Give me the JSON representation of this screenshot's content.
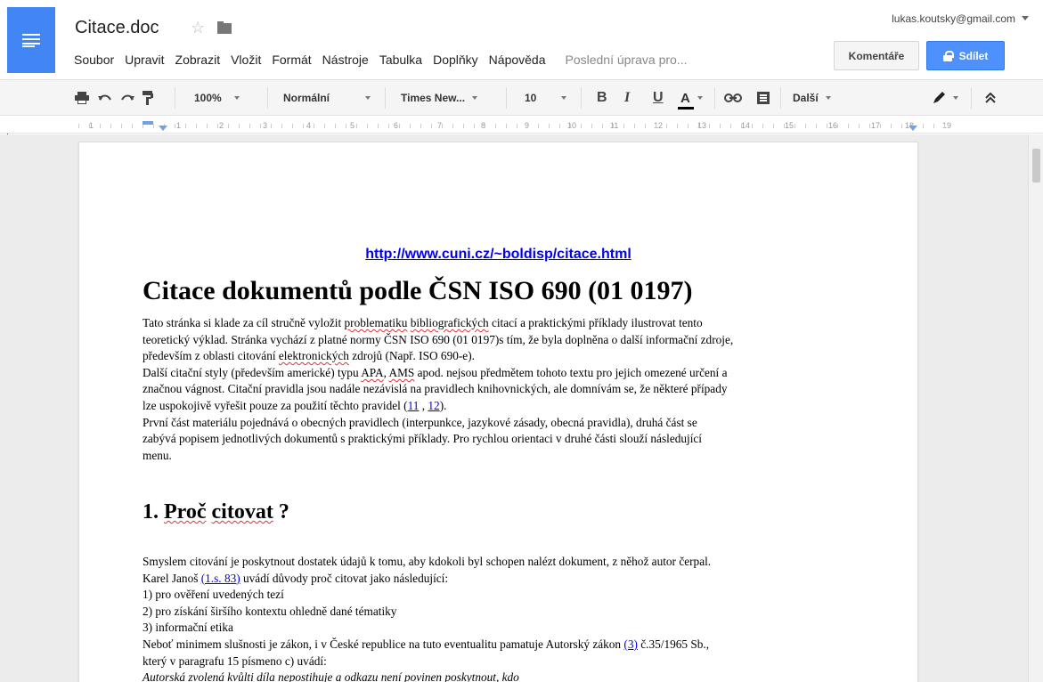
{
  "app": {
    "doc_title": "Citace.doc",
    "icons": [
      "docs-menu-icon",
      "star-icon",
      "folder-icon"
    ]
  },
  "menu": {
    "items": [
      "Soubor",
      "Upravit",
      "Zobrazit",
      "Vložit",
      "Formát",
      "Nástroje",
      "Tabulka",
      "Doplňky",
      "Nápověda"
    ],
    "last_edit": "Poslední úprava pro..."
  },
  "account": {
    "email": "lukas.koutsky@gmail.com"
  },
  "buttons": {
    "comments": "Komentáře",
    "share": "Sdílet"
  },
  "toolbar": {
    "zoom": "100%",
    "style": "Normální",
    "font": "Times New...",
    "size": "10",
    "bold": "B",
    "italic": "I",
    "underline": "U",
    "text_color": "A",
    "more": "Další"
  },
  "ruler": {
    "numbers": [
      "1",
      "1",
      "2",
      "3",
      "4",
      "5",
      "6",
      "7",
      "8",
      "9",
      "10",
      "11",
      "12",
      "13",
      "14",
      "15",
      "16",
      "17",
      "18",
      "19"
    ]
  },
  "document": {
    "link": "http://www.cuni.cz/~boldisp/citace.html",
    "heading1": "Citace dokumentů podle ČSN ISO 690 (01 0197)",
    "intro": {
      "l1a": "Tato stránka si klade za cíl stručně vyložit ",
      "l1b": "problematiku",
      "l1c": " ",
      "l1d": "bibliografických",
      "l1e": " citací a praktickými příklady ilustrovat tento",
      "l2": "teoretický výklad. Stránka vychází z platné normy ČSN ISO 690 (01 0197)s tím, že byla doplněna o další informační zdroje,",
      "l3a": "především z oblasti citování ",
      "l3b": "elektronických",
      "l3c": " zdrojů (Např. ISO 690-e).",
      "l4a": "Další citační styly (především americké) typu ",
      "l4b": "APA",
      "l4c": ", ",
      "l4d": "AMS",
      "l4e": " apod. nejsou předmětem tohoto textu pro jejich omezené určení a",
      "l5": "značnou vágnost. Citační pravidla jsou nadále nezávislá na pravidlech knihovnických, ale domnívám se, že některé případy",
      "l6a": "lze uspokojivě vyřešit pouze za použití těchto pravidel (",
      "l6b": "11",
      "l6c": " , ",
      "l6d": "12",
      "l6e": ").",
      "l7": "První část materiálu pojednává o obecných pravidlech (interpunkce, jazykové zásady, obecná pravidla), druhá část se",
      "l8": "zabývá popisem jednotlivých dokumentů s praktickými příklady. Pro rychlou orientaci v druhé části slouží následující",
      "l9": "menu."
    },
    "heading2": {
      "num": "1. ",
      "w1": "Proč",
      "sp": " ",
      "w2": "citovat",
      "q": " ?"
    },
    "section1": {
      "l1": "Smyslem citování je poskytnout dostatek údajů k tomu, aby kdokoli byl schopen nalézt dokument, z něhož autor čerpal.",
      "l2a": "Karel Janoš ",
      "l2b": "(1.s. 83)",
      "l2c": " uvádí důvody proč citovat jako následující:",
      "l3": "1) pro ověření uvedených tezí",
      "l4": "2) pro získání širšího kontextu ohledně dané tématiky",
      "l5": "3) informační etika",
      "l6a": "Neboť minimem slušnosti je zákon, i v České republice na tuto eventualitu pamatuje Autorský zákon ",
      "l6b": "(3)",
      "l6c": " č.35/1965 Sb.,",
      "l7": "který v paragrafu 15 písmeno c) uvádí:",
      "l8": "Autorská zvolená kvůlti díla nepostihuje a odkazu není povinen poskytnout, kdo"
    }
  }
}
